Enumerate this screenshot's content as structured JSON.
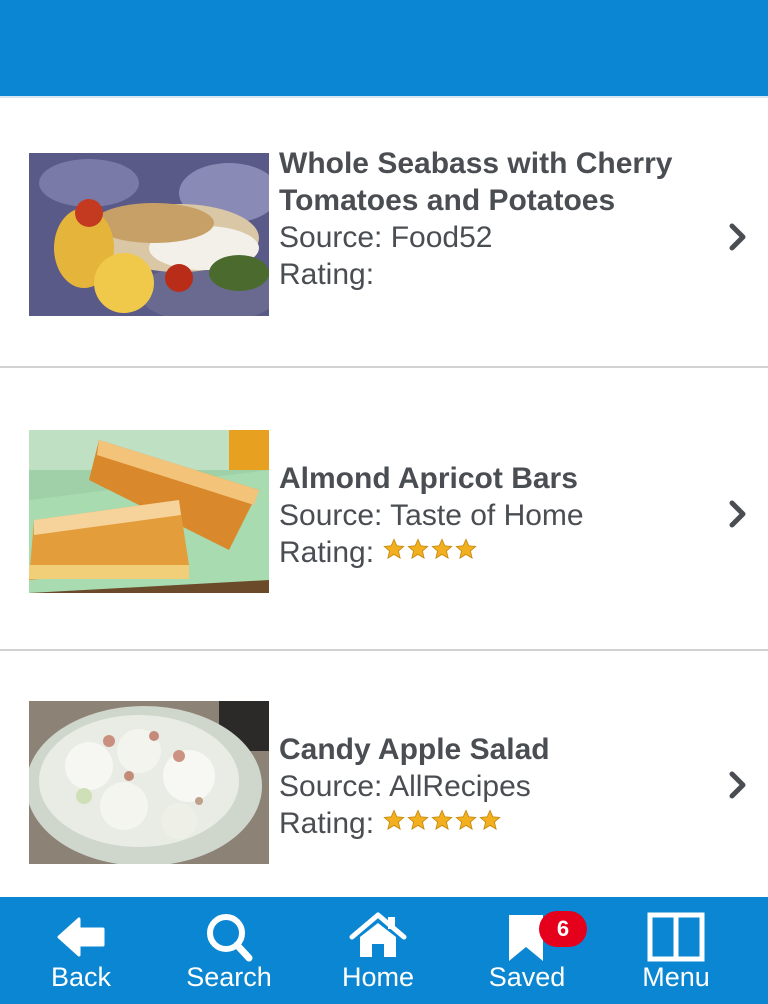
{
  "header": {},
  "recipes": [
    {
      "title": "Whole Seabass with Cherry Tomatoes and Potatoes",
      "source": "Source: Food52",
      "rating_label": "Rating:",
      "rating": 0
    },
    {
      "title": "Almond Apricot Bars",
      "source": "Source: Taste of Home",
      "rating_label": "Rating:",
      "rating": 4
    },
    {
      "title": "Candy Apple Salad",
      "source": "Source: AllRecipes",
      "rating_label": "Rating:",
      "rating": 5
    }
  ],
  "tabbar": {
    "back_label": "Back",
    "search_label": "Search",
    "home_label": "Home",
    "saved_label": "Saved",
    "saved_count": "6",
    "menu_label": "Menu"
  },
  "colors": {
    "brand_blue": "#0a86d2",
    "text_gray": "#4a4d52",
    "badge_red": "#e5001b",
    "star_gold": "#f2b01e"
  }
}
